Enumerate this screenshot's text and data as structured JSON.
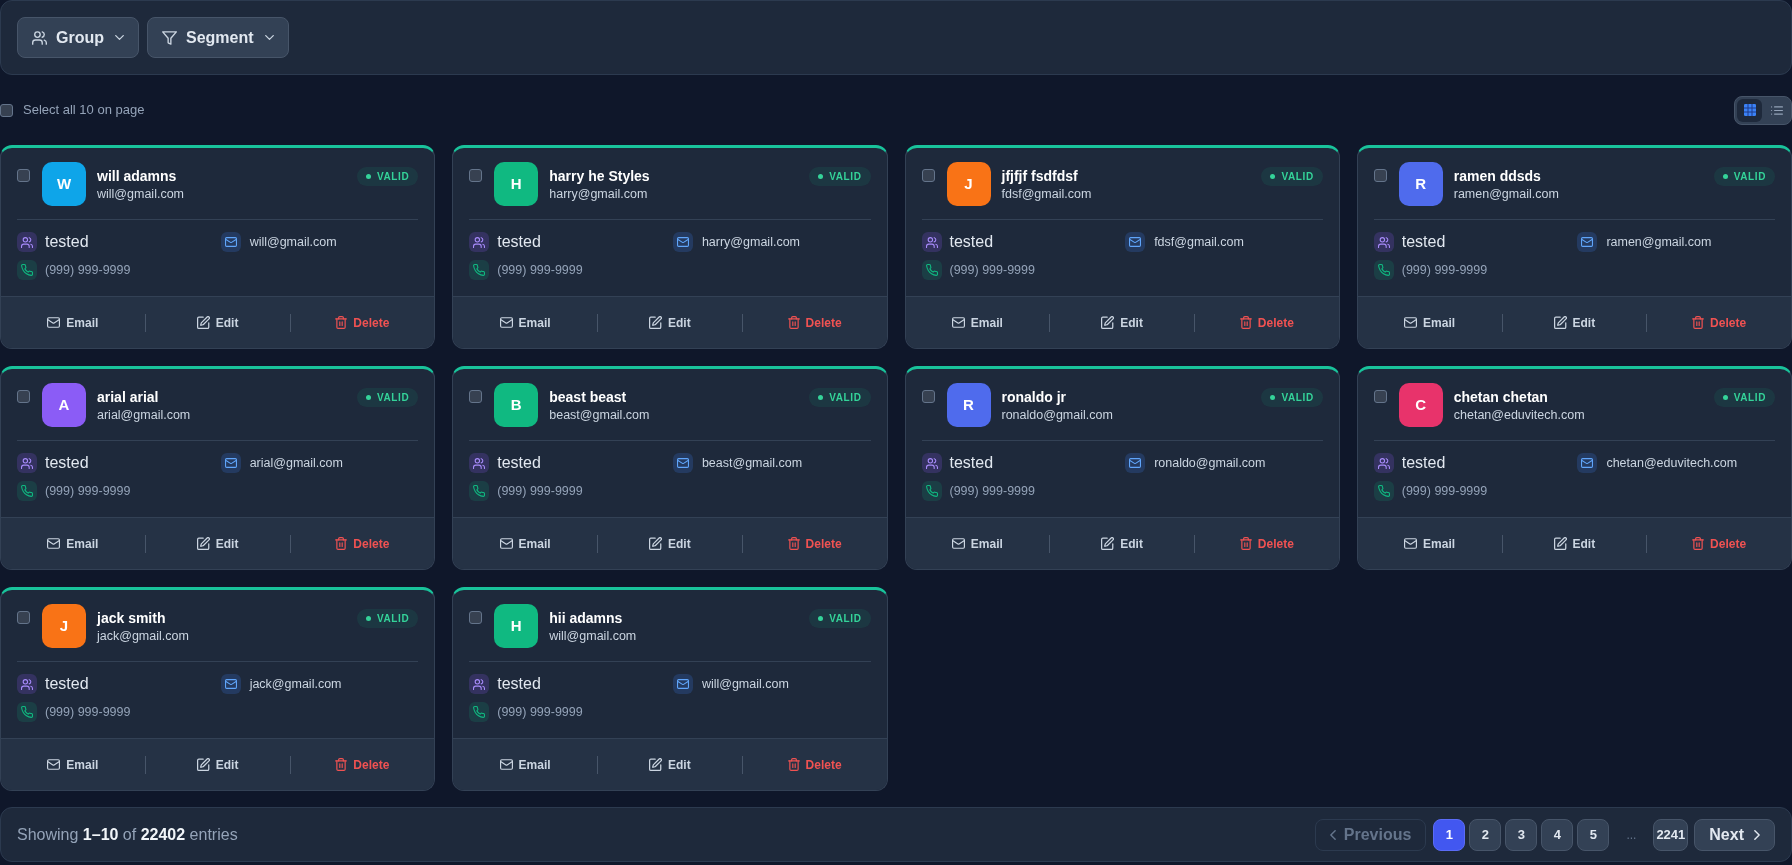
{
  "toolbar": {
    "filters": [
      {
        "kind": "group",
        "label": "Group"
      },
      {
        "kind": "segment",
        "label": "Segment"
      }
    ]
  },
  "select_all": {
    "label": "Select all 10 on page",
    "checked": false
  },
  "view_toggle": [
    {
      "kind": "grid",
      "selected": true
    },
    {
      "kind": "list",
      "selected": false
    }
  ],
  "contacts": [
    {
      "initial": "W",
      "color": "#0ea5e9",
      "name": "will adamns",
      "email": "will@gmail.com",
      "status": "VALID",
      "selected": false,
      "group": "tested",
      "contact_email": "will@gmail.com",
      "phone": "(999) 999-9999",
      "actions": [
        {
          "kind": "email",
          "label": "Email"
        },
        {
          "kind": "edit",
          "label": "Edit"
        },
        {
          "kind": "delete",
          "label": "Delete"
        }
      ]
    },
    {
      "initial": "H",
      "color": "#10b981",
      "name": "harry he Styles",
      "email": "harry@gmail.com",
      "status": "VALID",
      "selected": false,
      "group": "tested",
      "contact_email": "harry@gmail.com",
      "phone": "(999) 999-9999",
      "actions": [
        {
          "kind": "email",
          "label": "Email"
        },
        {
          "kind": "edit",
          "label": "Edit"
        },
        {
          "kind": "delete",
          "label": "Delete"
        }
      ]
    },
    {
      "initial": "J",
      "color": "#f97316",
      "name": "jfjfjf fsdfdsf",
      "email": "fdsf@gmail.com",
      "status": "VALID",
      "selected": false,
      "group": "tested",
      "contact_email": "fdsf@gmail.com",
      "phone": "(999) 999-9999",
      "actions": [
        {
          "kind": "email",
          "label": "Email"
        },
        {
          "kind": "edit",
          "label": "Edit"
        },
        {
          "kind": "delete",
          "label": "Delete"
        }
      ]
    },
    {
      "initial": "R",
      "color": "#4f6bed",
      "name": "ramen ddsds",
      "email": "ramen@gmail.com",
      "status": "VALID",
      "selected": false,
      "group": "tested",
      "contact_email": "ramen@gmail.com",
      "phone": "(999) 999-9999",
      "actions": [
        {
          "kind": "email",
          "label": "Email"
        },
        {
          "kind": "edit",
          "label": "Edit"
        },
        {
          "kind": "delete",
          "label": "Delete"
        }
      ]
    },
    {
      "initial": "A",
      "color": "#8b5cf6",
      "name": "arial arial",
      "email": "arial@gmail.com",
      "status": "VALID",
      "selected": false,
      "group": "tested",
      "contact_email": "arial@gmail.com",
      "phone": "(999) 999-9999",
      "actions": [
        {
          "kind": "email",
          "label": "Email"
        },
        {
          "kind": "edit",
          "label": "Edit"
        },
        {
          "kind": "delete",
          "label": "Delete"
        }
      ]
    },
    {
      "initial": "B",
      "color": "#10b981",
      "name": "beast beast",
      "email": "beast@gmail.com",
      "status": "VALID",
      "selected": false,
      "group": "tested",
      "contact_email": "beast@gmail.com",
      "phone": "(999) 999-9999",
      "actions": [
        {
          "kind": "email",
          "label": "Email"
        },
        {
          "kind": "edit",
          "label": "Edit"
        },
        {
          "kind": "delete",
          "label": "Delete"
        }
      ]
    },
    {
      "initial": "R",
      "color": "#4f6bed",
      "name": "ronaldo jr",
      "email": "ronaldo@gmail.com",
      "status": "VALID",
      "selected": false,
      "group": "tested",
      "contact_email": "ronaldo@gmail.com",
      "phone": "(999) 999-9999",
      "actions": [
        {
          "kind": "email",
          "label": "Email"
        },
        {
          "kind": "edit",
          "label": "Edit"
        },
        {
          "kind": "delete",
          "label": "Delete"
        }
      ]
    },
    {
      "initial": "C",
      "color": "#e8336b",
      "name": "chetan chetan",
      "email": "chetan@eduvitech.com",
      "status": "VALID",
      "selected": false,
      "group": "tested",
      "contact_email": "chetan@eduvitech.com",
      "phone": "(999) 999-9999",
      "actions": [
        {
          "kind": "email",
          "label": "Email"
        },
        {
          "kind": "edit",
          "label": "Edit"
        },
        {
          "kind": "delete",
          "label": "Delete"
        }
      ]
    },
    {
      "initial": "J",
      "color": "#f97316",
      "name": "jack smith",
      "email": "jack@gmail.com",
      "status": "VALID",
      "selected": false,
      "group": "tested",
      "contact_email": "jack@gmail.com",
      "phone": "(999) 999-9999",
      "actions": [
        {
          "kind": "email",
          "label": "Email"
        },
        {
          "kind": "edit",
          "label": "Edit"
        },
        {
          "kind": "delete",
          "label": "Delete"
        }
      ]
    },
    {
      "initial": "H",
      "color": "#10b981",
      "name": "hii adamns",
      "email": "will@gmail.com",
      "status": "VALID",
      "selected": false,
      "group": "tested",
      "contact_email": "will@gmail.com",
      "phone": "(999) 999-9999",
      "actions": [
        {
          "kind": "email",
          "label": "Email"
        },
        {
          "kind": "edit",
          "label": "Edit"
        },
        {
          "kind": "delete",
          "label": "Delete"
        }
      ]
    }
  ],
  "pagination": {
    "summary": "Showing **1–10** of **22402** entries",
    "previous": {
      "label": "Previous",
      "disabled": true
    },
    "pages": [
      {
        "label": "1",
        "selected": true
      },
      {
        "label": "2",
        "selected": false
      },
      {
        "label": "3",
        "selected": false
      },
      {
        "label": "4",
        "selected": false
      },
      {
        "label": "5",
        "selected": false
      }
    ],
    "ellipsis": "...",
    "last_page": {
      "label": "2241",
      "selected": false
    },
    "next": {
      "label": "Next",
      "disabled": false
    }
  }
}
